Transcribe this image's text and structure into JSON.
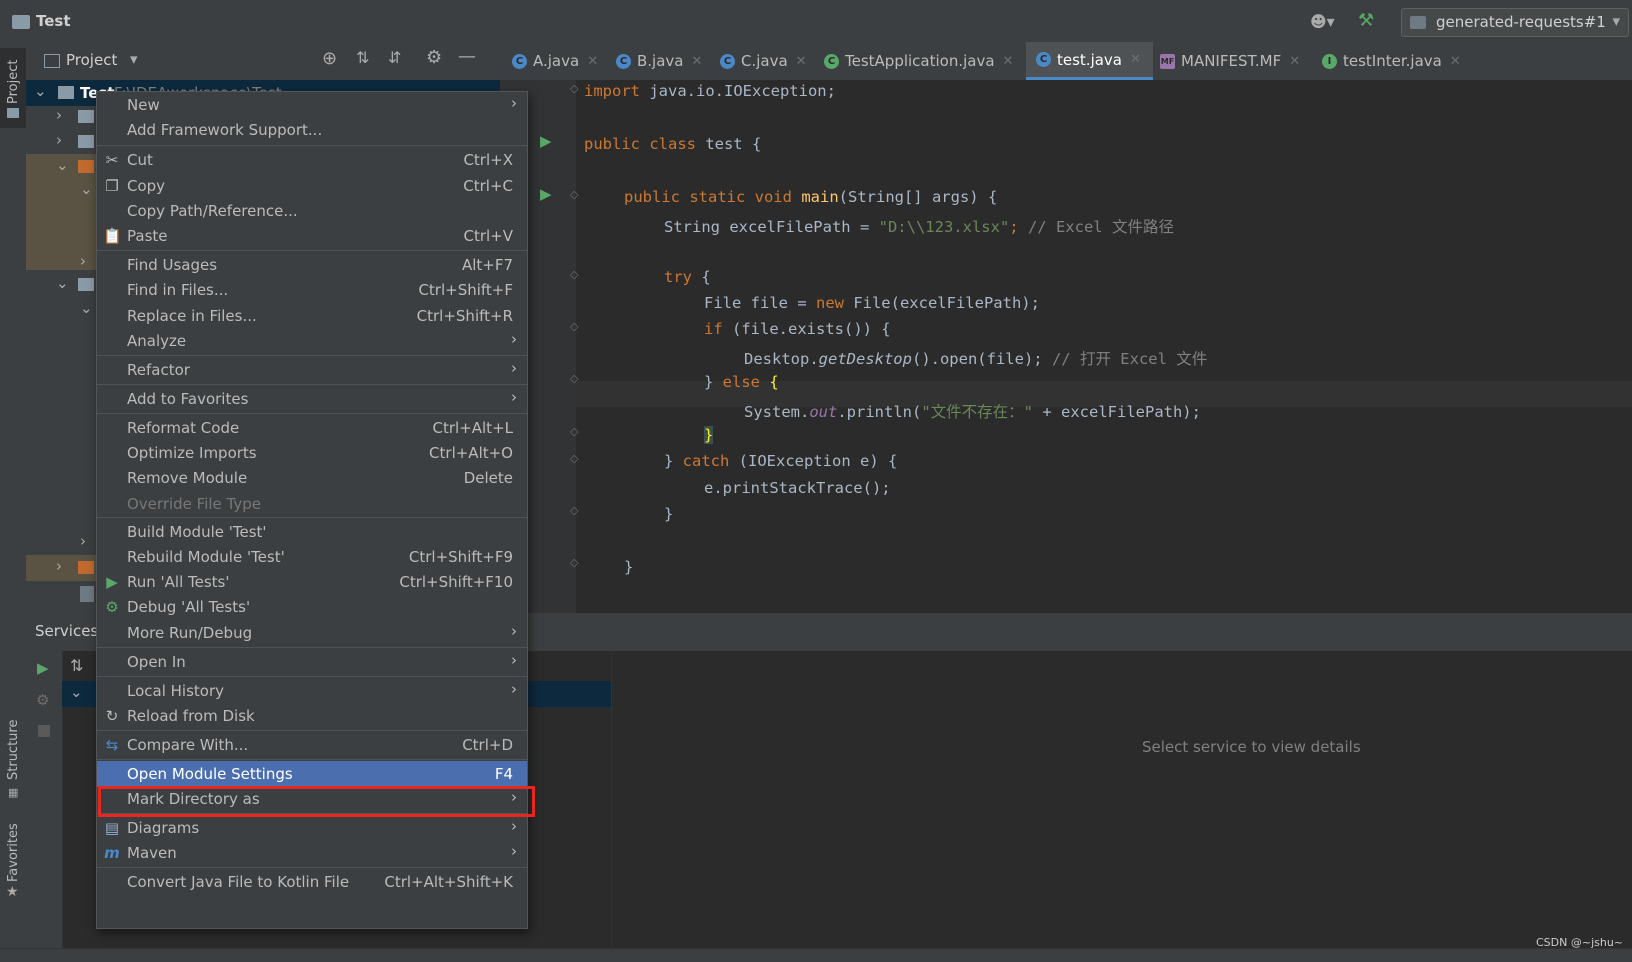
{
  "titlebar": {
    "title": "Test",
    "run_config": "generated-requests#1"
  },
  "left_stripe": {
    "project_label": "Project",
    "structure_label": "Structure",
    "favorites_label": "Favorites"
  },
  "project_panel": {
    "title": "Project",
    "root_name": "Test",
    "root_path": "F:\\IDEAworkspace\\Test"
  },
  "tabs": [
    {
      "label": "A.java",
      "icon": "class-icon"
    },
    {
      "label": "B.java",
      "icon": "class-icon"
    },
    {
      "label": "C.java",
      "icon": "class-icon"
    },
    {
      "label": "TestApplication.java",
      "icon": "app-class-icon"
    },
    {
      "label": "test.java",
      "icon": "class-icon",
      "active": true
    },
    {
      "label": "MANIFEST.MF",
      "icon": "manifest-icon"
    },
    {
      "label": "testInter.java",
      "icon": "interface-icon"
    }
  ],
  "code": {
    "line1": "import java.io.IOException;",
    "import_kw": "import",
    "import_rest": " java.io.IOException;",
    "class_decl_kw": "public class",
    "class_name": " test {",
    "main_kw": "public static void",
    "main_fn": "main",
    "main_rest": "(String[] args) {",
    "l_string": "String excelFilePath = ",
    "l_string_lit": "\"D:\\\\123.xlsx\"",
    "l_string_end": "; ",
    "l_string_cmt": "// Excel 文件路径",
    "try_kw": "try",
    "try_rest": " {",
    "file_a": "File file = ",
    "file_new": "new",
    "file_b": " File(excelFilePath);",
    "if_kw": "if",
    "if_rest": " (file.exists()) {",
    "desk_a": "Desktop.",
    "desk_it": "getDesktop",
    "desk_b": "().open(file); ",
    "desk_cmt": "// 打开 Excel 文件",
    "else_a": "} ",
    "else_kw": "else",
    "else_b": " {",
    "sys_a": "System.",
    "sys_it": "out",
    "sys_b": ".println(",
    "sys_str": "\"文件不存在：\"",
    "sys_c": " + excelFilePath);",
    "close_brace": "}",
    "catch_a": "} ",
    "catch_kw": "catch",
    "catch_b": " (IOException e) {",
    "trace": "e.printStackTrace();"
  },
  "services": {
    "title": "Services",
    "empty_text": "Select service to view details"
  },
  "watermark": "CSDN @~jshu~",
  "menu": [
    {
      "label": "New",
      "submenu": true
    },
    {
      "label": "Add Framework Support..."
    },
    {
      "label": "Cut",
      "shortcut": "Ctrl+X",
      "icon": "scissors-icon"
    },
    {
      "label": "Copy",
      "shortcut": "Ctrl+C",
      "icon": "copy-icon"
    },
    {
      "label": "Copy Path/Reference..."
    },
    {
      "label": "Paste",
      "shortcut": "Ctrl+V",
      "icon": "paste-icon"
    },
    {
      "label": "Find Usages",
      "shortcut": "Alt+F7"
    },
    {
      "label": "Find in Files...",
      "shortcut": "Ctrl+Shift+F"
    },
    {
      "label": "Replace in Files...",
      "shortcut": "Ctrl+Shift+R"
    },
    {
      "label": "Analyze",
      "submenu": true
    },
    {
      "label": "Refactor",
      "submenu": true
    },
    {
      "label": "Add to Favorites",
      "submenu": true
    },
    {
      "label": "Reformat Code",
      "shortcut": "Ctrl+Alt+L"
    },
    {
      "label": "Optimize Imports",
      "shortcut": "Ctrl+Alt+O"
    },
    {
      "label": "Remove Module",
      "shortcut": "Delete"
    },
    {
      "label": "Override File Type",
      "disabled": true
    },
    {
      "label": "Build Module 'Test'"
    },
    {
      "label": "Rebuild Module 'Test'",
      "shortcut": "Ctrl+Shift+F9"
    },
    {
      "label": "Run 'All Tests'",
      "shortcut": "Ctrl+Shift+F10",
      "icon": "run-icon"
    },
    {
      "label": "Debug 'All Tests'",
      "icon": "debug-icon"
    },
    {
      "label": "More Run/Debug",
      "submenu": true
    },
    {
      "label": "Open In",
      "submenu": true
    },
    {
      "label": "Local History",
      "submenu": true
    },
    {
      "label": "Reload from Disk",
      "icon": "reload-icon"
    },
    {
      "label": "Compare With...",
      "shortcut": "Ctrl+D",
      "icon": "compare-icon"
    },
    {
      "label": "Open Module Settings",
      "shortcut": "F4",
      "selected": true
    },
    {
      "label": "Mark Directory as",
      "submenu": true
    },
    {
      "label": "Diagrams",
      "submenu": true,
      "icon": "diagram-icon"
    },
    {
      "label": "Maven",
      "submenu": true,
      "icon": "maven-icon"
    },
    {
      "label": "Convert Java File to Kotlin File",
      "shortcut": "Ctrl+Alt+Shift+K"
    }
  ],
  "colors": {
    "selection": "#4b6eaf",
    "highlight_box": "#e8251e",
    "active_tab_underline": "#4a88c7"
  }
}
